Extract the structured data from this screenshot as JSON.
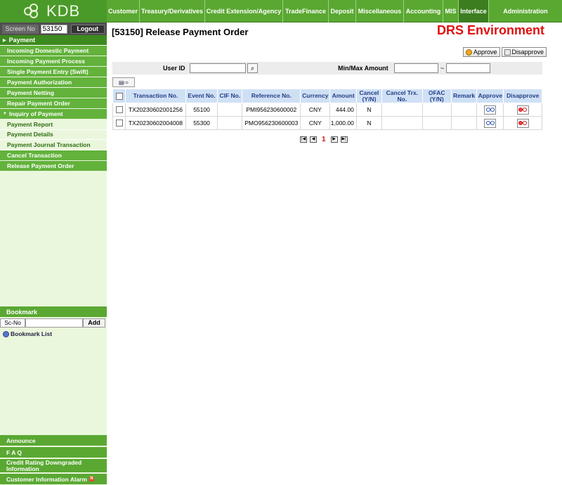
{
  "brand": {
    "logo_text": "KDB"
  },
  "top_nav": [
    {
      "label": "Customer"
    },
    {
      "label": "Treasury/Derivatives"
    },
    {
      "label": "Credit Extension/Agency"
    },
    {
      "label": "TradeFinance"
    },
    {
      "label": "Deposit"
    },
    {
      "label": "Miscellaneous"
    },
    {
      "label": "Accounting"
    },
    {
      "label": "MIS"
    },
    {
      "label": "Interface"
    },
    {
      "label": "Administration"
    }
  ],
  "screen_bar": {
    "label": "Screen No",
    "value": "53150",
    "logout_label": "Logout"
  },
  "sidebar": {
    "section_title": "Payment",
    "items": [
      {
        "label": "Incoming Domestic Payment"
      },
      {
        "label": "Incoming Payment Process"
      },
      {
        "label": "Single Payment Entry (Swift)"
      },
      {
        "label": "Payment Authorization"
      },
      {
        "label": "Payment Netting"
      },
      {
        "label": "Repair Payment Order"
      }
    ],
    "group_title": "Inquiry of Payment",
    "group_items": [
      {
        "label": "Payment Report"
      },
      {
        "label": "Payment Details"
      },
      {
        "label": "Payment Journal Transaction"
      }
    ],
    "tail_items": [
      {
        "label": "Cancel Transaction"
      },
      {
        "label": "Release Payment Order"
      }
    ]
  },
  "bookmark": {
    "title": "Bookmark",
    "sc_no_label": "Sc-No",
    "add_label": "Add",
    "list_label": "Bookmark List"
  },
  "footer_menu": {
    "announce": "Announce",
    "faq": "F A Q",
    "credit_rating": "Credit Rating Downgraded Information",
    "customer_alarm": "Customer Information Alarm",
    "new_badge": "N"
  },
  "page": {
    "title": "[53150] Release Payment Order",
    "environment": "DRS Environment",
    "approve_label": "Approve",
    "disapprove_label": "Disapprove"
  },
  "search": {
    "user_id_label": "User ID",
    "user_id_value": "",
    "amount_label": "Min/Max Amount",
    "min_amount": "",
    "max_amount": "",
    "range_sep": "~"
  },
  "table": {
    "headers": [
      "Transaction No.",
      "Event No.",
      "CIF No.",
      "Reference No.",
      "Currency",
      "Amount",
      "Cancel (Y/N)",
      "Cancel Trx. No.",
      "OFAC (Y/N)",
      "Remark",
      "Approve",
      "Disapprove"
    ],
    "rows": [
      {
        "transaction_no": "TX20230602001256",
        "event_no": "55100",
        "cif_no": "",
        "reference_no": "PMI956230600002",
        "currency": "CNY",
        "amount": "444.00",
        "cancel": "N",
        "cancel_trx_no": "",
        "ofac": "",
        "remark": ""
      },
      {
        "transaction_no": "TX20230602004008",
        "event_no": "55300",
        "cif_no": "",
        "reference_no": "PMO956230600003",
        "currency": "CNY",
        "amount": "1,000.00",
        "cancel": "N",
        "cancel_trx_no": "",
        "ofac": "",
        "remark": ""
      }
    ]
  },
  "pager": {
    "current_page": "1"
  },
  "colors": {
    "nav_green": "#5aa832",
    "env_red": "#e01010",
    "header_blue": "#cfe0f5"
  }
}
